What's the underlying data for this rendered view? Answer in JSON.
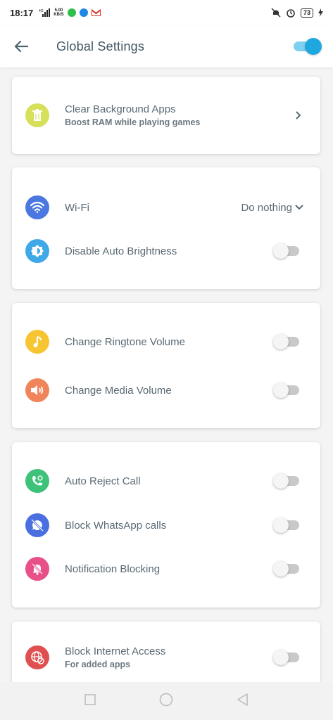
{
  "status_bar": {
    "time": "18:17",
    "net_speed_value": "5.00",
    "net_speed_unit": "KB/S",
    "signal": "4G",
    "battery": "73"
  },
  "header": {
    "title": "Global Settings",
    "master_toggle_on": true
  },
  "cards": {
    "clear_bg": {
      "label": "Clear Background Apps",
      "sublabel": "Boost RAM while playing games",
      "icon": "trash-icon",
      "icon_color": "#d6e05a"
    },
    "wifi": {
      "label": "Wi-Fi",
      "value": "Do nothing",
      "icon": "wifi-icon",
      "icon_color": "#4a78e0"
    },
    "brightness": {
      "label": "Disable Auto Brightness",
      "icon": "brightness-icon",
      "icon_color": "#3fa9e8",
      "on": false
    },
    "ringtone": {
      "label": "Change Ringtone Volume",
      "icon": "music-note-icon",
      "icon_color": "#f7c532",
      "on": false
    },
    "media": {
      "label": "Change Media Volume",
      "icon": "speaker-icon",
      "icon_color": "#f0845a",
      "on": false
    },
    "reject_call": {
      "label": "Auto Reject Call",
      "icon": "phone-icon",
      "icon_color": "#3ec27a",
      "on": false
    },
    "whatsapp": {
      "label": "Block WhatsApp calls",
      "icon": "whatsapp-off-icon",
      "icon_color": "#4a6fe0",
      "on": false
    },
    "notification": {
      "label": "Notification Blocking",
      "icon": "bell-off-icon",
      "icon_color": "#e8508a",
      "on": false
    },
    "internet": {
      "label": "Block Internet Access",
      "sublabel": "For added apps",
      "icon": "globe-block-icon",
      "icon_color": "#e05050",
      "on": false
    }
  },
  "accent_color": "#1fa8e0"
}
